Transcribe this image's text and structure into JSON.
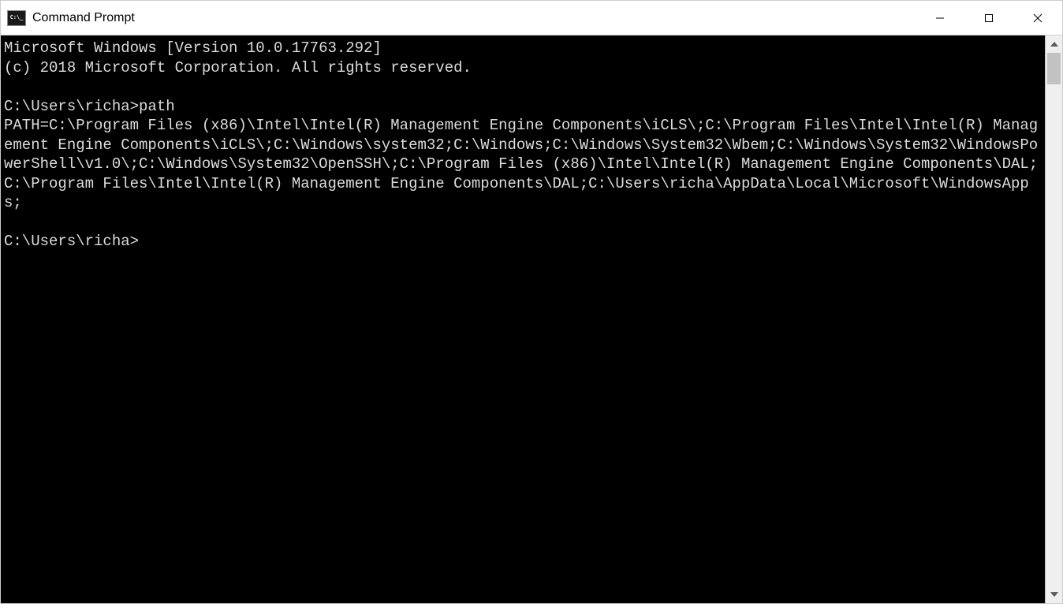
{
  "window": {
    "title": "Command Prompt"
  },
  "console": {
    "header_line1": "Microsoft Windows [Version 10.0.17763.292]",
    "header_line2": "(c) 2018 Microsoft Corporation. All rights reserved.",
    "prompt1": "C:\\Users\\richa>",
    "command1": "path",
    "output1": "PATH=C:\\Program Files (x86)\\Intel\\Intel(R) Management Engine Components\\iCLS\\;C:\\Program Files\\Intel\\Intel(R) Management Engine Components\\iCLS\\;C:\\Windows\\system32;C:\\Windows;C:\\Windows\\System32\\Wbem;C:\\Windows\\System32\\WindowsPowerShell\\v1.0\\;C:\\Windows\\System32\\OpenSSH\\;C:\\Program Files (x86)\\Intel\\Intel(R) Management Engine Components\\DAL;C:\\Program Files\\Intel\\Intel(R) Management Engine Components\\DAL;C:\\Users\\richa\\AppData\\Local\\Microsoft\\WindowsApps;",
    "prompt2": "C:\\Users\\richa>"
  }
}
